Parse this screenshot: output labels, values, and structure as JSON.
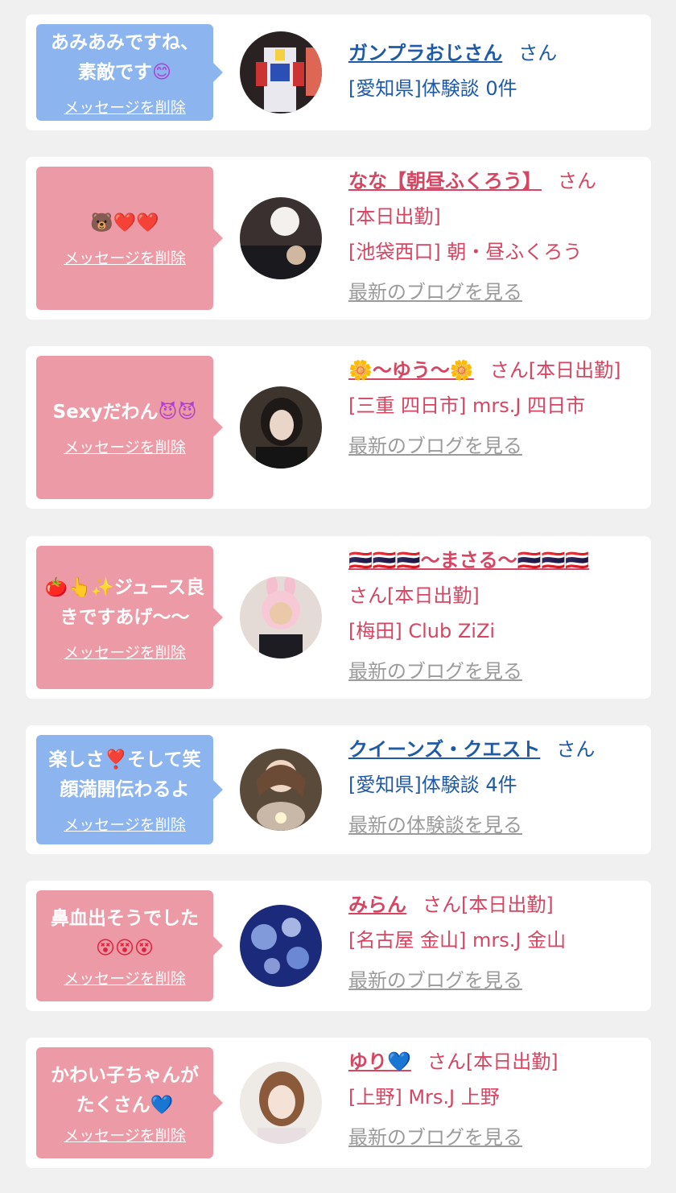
{
  "messages": [
    {
      "bubble_color": "blue",
      "message": "あみあみですね、素敵です",
      "emoji": "😊",
      "delete_label": "メッセージを削除",
      "name": "ガンプラおじさん",
      "honorific": "さん",
      "lines": [
        "[愛知県]体験談 0件"
      ],
      "link": "",
      "avatar_icon": "gundam-figure-avatar"
    },
    {
      "bubble_color": "pink",
      "message": "",
      "emoji": "🐻❤️❤️",
      "delete_label": "メッセージを削除",
      "name": "なな【朝昼ふくろう】",
      "honorific": "さん",
      "lines": [
        "[本日出勤]",
        "[池袋西口] 朝・昼ふくろう"
      ],
      "link": "最新のブログを見る",
      "avatar_icon": "girl-photo-avatar"
    },
    {
      "bubble_color": "pink",
      "message": "Sexyだわん",
      "emoji": "😈😈",
      "delete_label": "メッセージを削除",
      "name": "🌼〜ゆう〜🌼",
      "honorific": "さん[本日出勤]",
      "lines": [
        "[三重 四日市] mrs.J 四日市"
      ],
      "link": "最新のブログを見る",
      "avatar_icon": "girl-photo-avatar"
    },
    {
      "bubble_color": "pink",
      "message": "ジュース良きですあげ〜〜",
      "emoji": "🍅👆✨",
      "delete_label": "メッセージを削除",
      "name": "🇹🇭🇹🇭🇹🇭〜まさる〜🇹🇭🇹🇭🇹🇭",
      "honorific": "さん[本日出勤]",
      "lines": [
        "[梅田] Club ZiZi"
      ],
      "link": "最新のブログを見る",
      "avatar_icon": "bunny-hood-avatar"
    },
    {
      "bubble_color": "blue",
      "message": "楽しさ❣️そして笑顔満開伝わるよ",
      "emoji": "",
      "delete_label": "メッセージを削除",
      "name": "クイーンズ・クエスト",
      "honorific": "さん",
      "lines": [
        "[愛知県]体験談 4件"
      ],
      "link": "最新の体験談を見る",
      "avatar_icon": "fantasy-girl-avatar"
    },
    {
      "bubble_color": "pink",
      "message": "鼻血出そうでした",
      "emoji": "😵😵😵",
      "delete_label": "メッセージを削除",
      "name": "みらん",
      "honorific": "さん[本日出勤]",
      "lines": [
        "[名古屋 金山] mrs.J 金山"
      ],
      "link": "最新のブログを見る",
      "avatar_icon": "jellyfish-avatar"
    },
    {
      "bubble_color": "pink",
      "message": "かわい子ちゃんがたくさん💙",
      "emoji": "",
      "delete_label": "メッセージを削除",
      "name": "ゆり💙",
      "honorific": "さん[本日出勤]",
      "lines": [
        "[上野] Mrs.J 上野"
      ],
      "link": "最新のブログを見る",
      "avatar_icon": "girl-photo-avatar"
    }
  ]
}
